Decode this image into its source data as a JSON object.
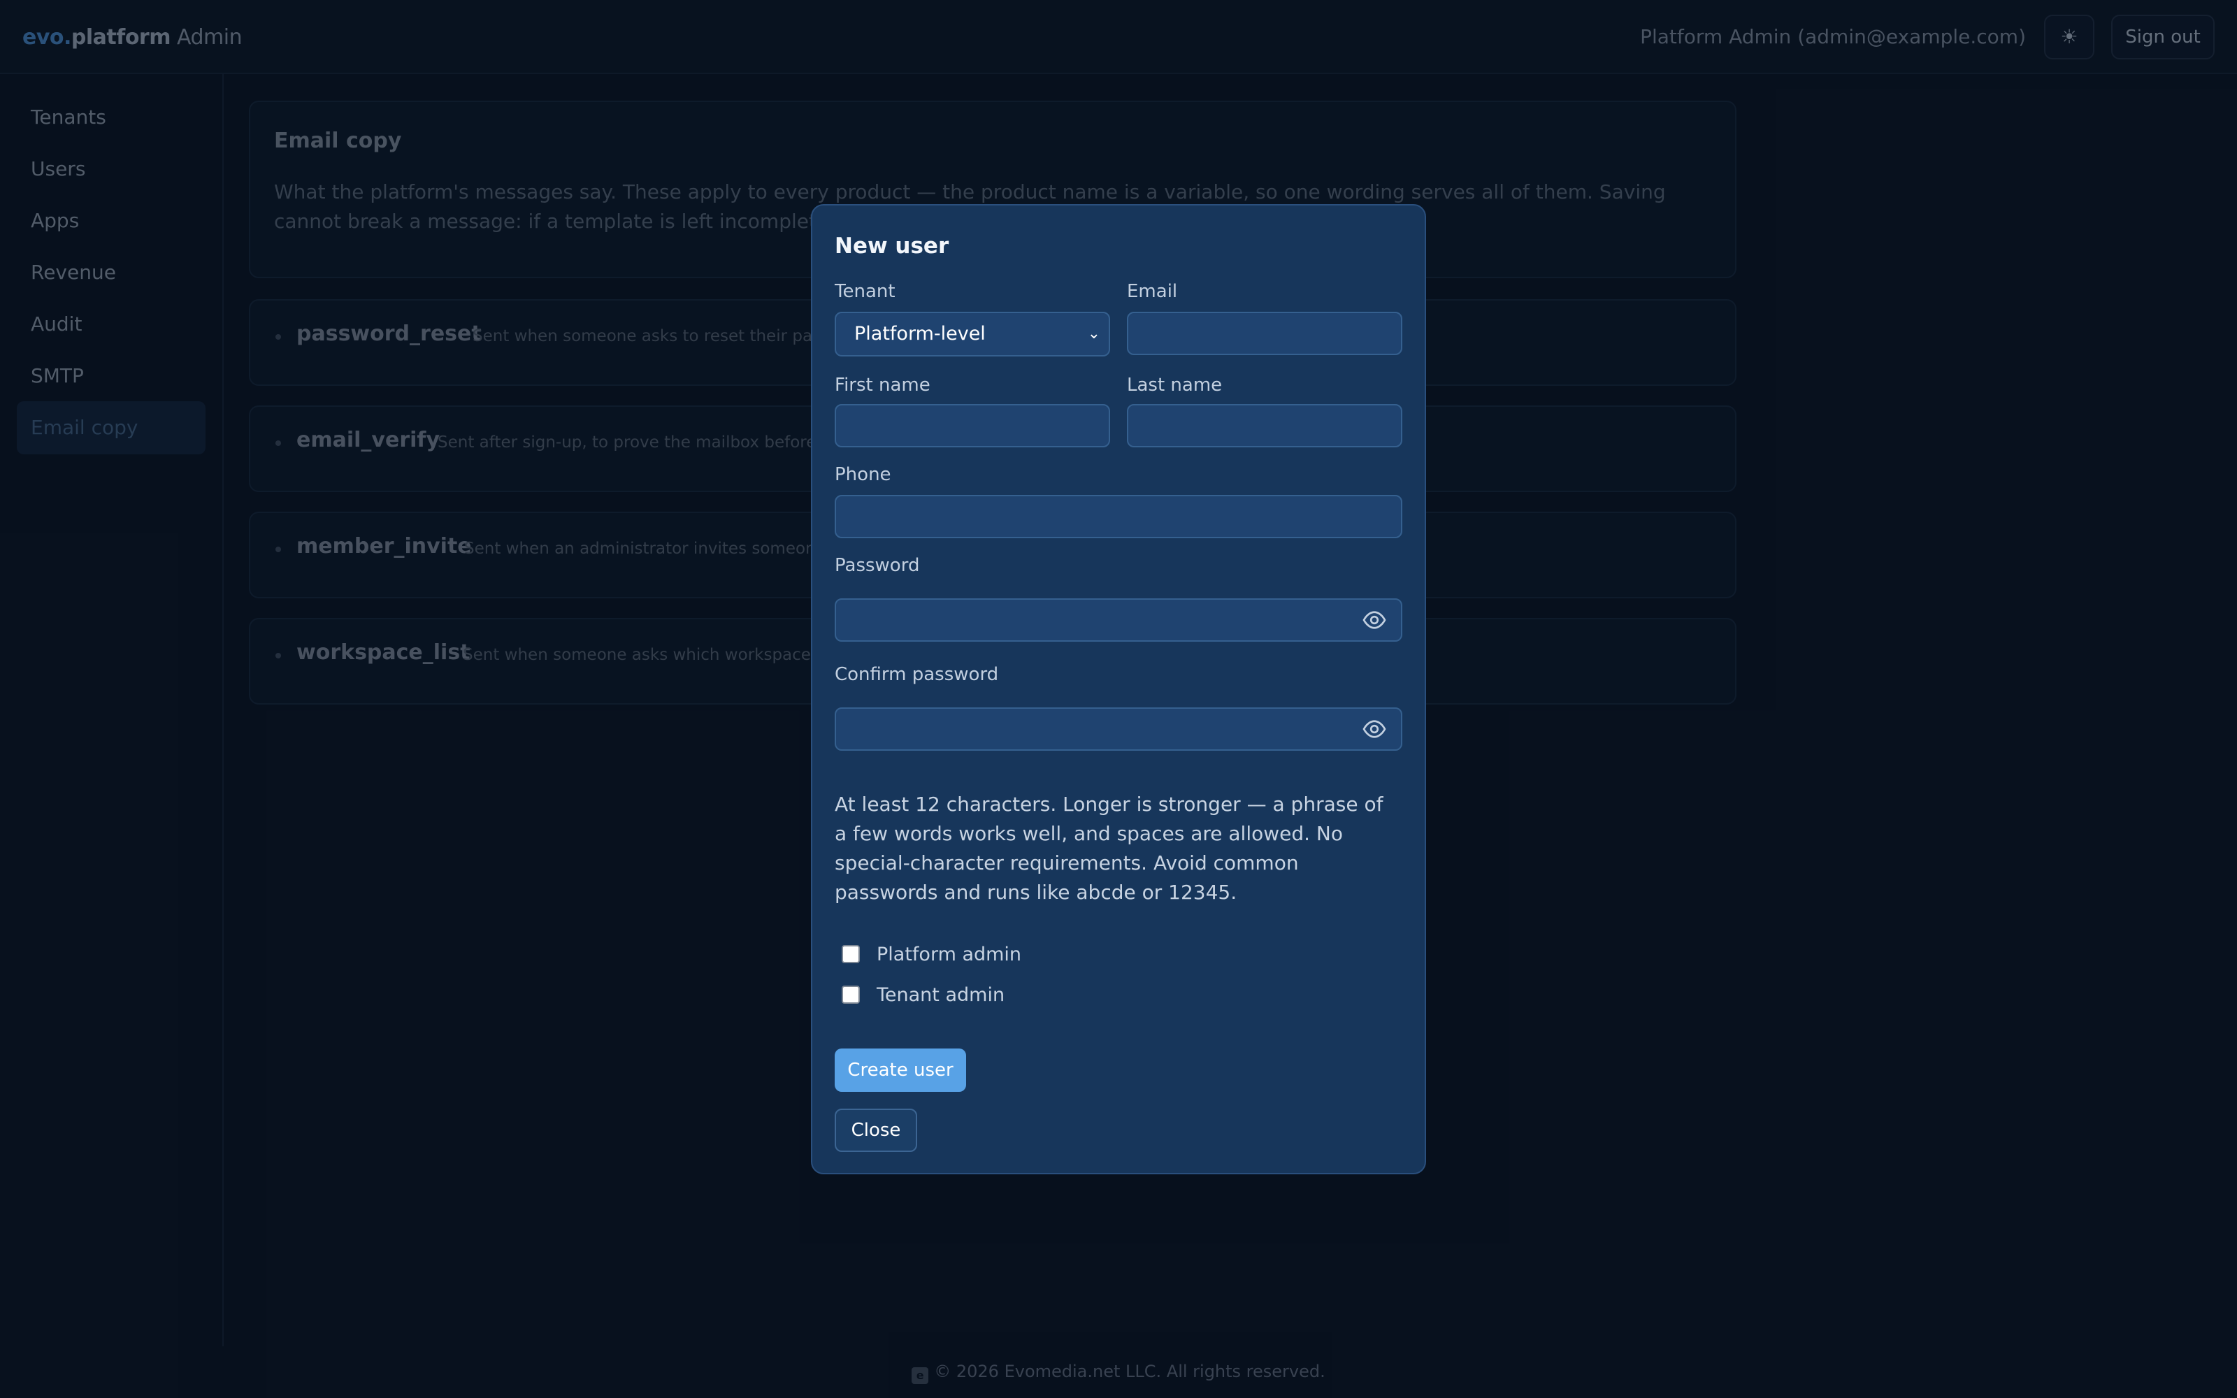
{
  "header": {
    "brand_evo": "evo.",
    "brand_platform": "platform",
    "brand_admin": " Admin",
    "user": "Platform Admin (admin@example.com)",
    "theme_icon": "sun-icon",
    "signout_label": "Sign out"
  },
  "sidebar": {
    "items": [
      {
        "label": "Tenants"
      },
      {
        "label": "Users"
      },
      {
        "label": "Apps"
      },
      {
        "label": "Revenue"
      },
      {
        "label": "Audit"
      },
      {
        "label": "SMTP"
      },
      {
        "label": "Email copy"
      }
    ],
    "active": "Email copy"
  },
  "main": {
    "title": "Email copy",
    "description": "What the platform's messages say. These apply to every product — the product name is a variable, so one wording serves all of them. Saving cannot break a message: if a template is left incomplete, the built-in copy i",
    "templates": [
      {
        "name": "password_reset",
        "description": "Sent when someone asks to reset their pass"
      },
      {
        "name": "email_verify",
        "description": "Sent after sign-up, to prove the mailbox before f"
      },
      {
        "name": "member_invite",
        "description": "Sent when an administrator invites someone"
      },
      {
        "name": "workspace_list",
        "description": "Sent when someone asks which workspaces"
      }
    ]
  },
  "modal": {
    "title": "New user",
    "tenant_label": "Tenant",
    "tenant_value": "Platform-level",
    "email_label": "Email",
    "first_name_label": "First name",
    "last_name_label": "Last name",
    "phone_label": "Phone",
    "password_label": "Password",
    "confirm_password_label": "Confirm password",
    "help_text": "At least 12 characters. Longer is stronger — a phrase of a few words works well, and spaces are allowed. No special-character requirements. Avoid common passwords and runs like abcde or 12345.",
    "platform_admin_label": "Platform admin",
    "tenant_admin_label": "Tenant admin",
    "create_label": "Create user",
    "close_label": "Close"
  },
  "footer": {
    "text": "© 2026 Evomedia.net LLC. All rights reserved."
  }
}
